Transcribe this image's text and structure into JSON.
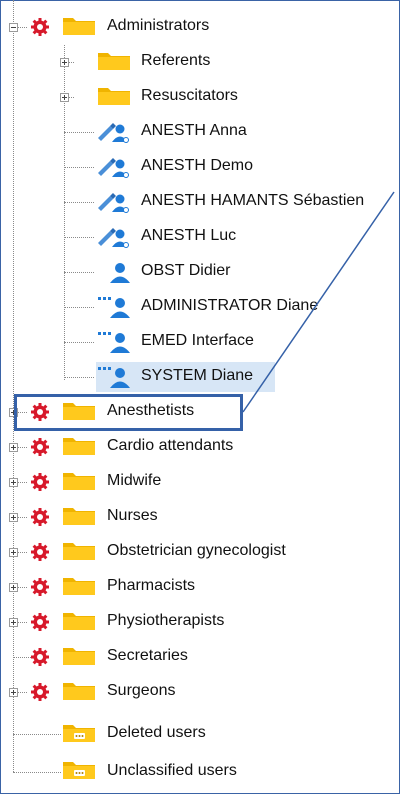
{
  "tree": {
    "root_items": [
      {
        "label": "Administrators",
        "expanded": true
      },
      {
        "label": "Anesthetists",
        "expanded": false,
        "highlighted": true
      },
      {
        "label": "Cardio attendants",
        "expanded": false
      },
      {
        "label": "Midwife",
        "expanded": false
      },
      {
        "label": "Nurses",
        "expanded": false
      },
      {
        "label": "Obstetrician gynecologist",
        "expanded": false
      },
      {
        "label": "Pharmacists",
        "expanded": false
      },
      {
        "label": "Physiotherapists",
        "expanded": false
      },
      {
        "label": "Secretaries",
        "expanded": false
      },
      {
        "label": "Surgeons",
        "expanded": false
      },
      {
        "label": "Deleted users"
      },
      {
        "label": "Unclassified users"
      }
    ],
    "admin_children": [
      {
        "label": "Referents",
        "type": "folder"
      },
      {
        "label": "Resuscitators",
        "type": "folder"
      },
      {
        "label": "ANESTH Anna",
        "type": "user-anesth"
      },
      {
        "label": "ANESTH Demo",
        "type": "user-anesth"
      },
      {
        "label": "ANESTH HAMANTS Sébastien",
        "type": "user-anesth"
      },
      {
        "label": "ANESTH Luc",
        "type": "user-anesth"
      },
      {
        "label": "OBST Didier",
        "type": "user"
      },
      {
        "label": "ADMINISTRATOR Diane",
        "type": "user-dots"
      },
      {
        "label": "EMED Interface",
        "type": "user-dots"
      },
      {
        "label": "SYSTEM Diane",
        "type": "user-dots",
        "selected": true
      }
    ]
  },
  "colors": {
    "accent": "#3561a8",
    "folder": "#ffc20e",
    "gear": "#d7192b",
    "user": "#1f7ad6"
  }
}
